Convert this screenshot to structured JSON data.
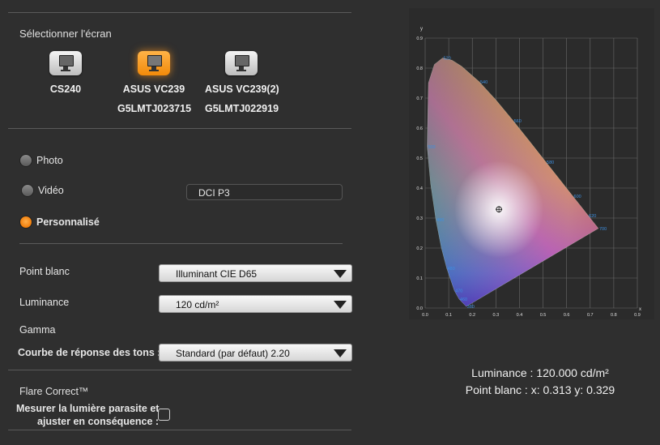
{
  "screen_select": {
    "title": "Sélectionner l'écran",
    "monitors": [
      {
        "name": "CS240",
        "serial": "",
        "active": false
      },
      {
        "name": "ASUS VC239",
        "serial": "G5LMTJ023715",
        "active": true
      },
      {
        "name": "ASUS VC239(2)",
        "serial": "G5LMTJ022919",
        "active": false
      }
    ]
  },
  "modes": {
    "photo": "Photo",
    "video": "Vidéo",
    "custom": "Personnalisé",
    "selected": "custom",
    "video_preset": "DCI P3"
  },
  "settings": {
    "white_point_label": "Point blanc",
    "white_point_value": "Illuminant CIE D65",
    "luminance_label": "Luminance",
    "luminance_value": "120 cd/m²",
    "gamma_label": "Gamma",
    "tone_curve_label": "Courbe de réponse des tons :",
    "tone_curve_value": "Standard (par défaut) 2.20"
  },
  "flare": {
    "title": "Flare Correct™",
    "measure_line1": "Mesurer la lumière parasite et",
    "measure_line2": "ajuster en conséquence :",
    "checked": false
  },
  "readout": {
    "luminance": "Luminance : 120.000 cd/m²",
    "white_point": "Point blanc : x: 0.313  y: 0.329"
  },
  "chart_data": {
    "type": "scatter",
    "title": "",
    "xlabel": "x",
    "ylabel": "y",
    "xlim": [
      0.0,
      0.9
    ],
    "ylim": [
      0.0,
      0.9
    ],
    "ticks": [
      "0.0",
      "0.1",
      "0.2",
      "0.3",
      "0.4",
      "0.5",
      "0.6",
      "0.7",
      "0.8",
      "0.9"
    ],
    "grid": true,
    "wavelength_labels": [
      {
        "text": "520",
        "x": 0.074,
        "y": 0.834
      },
      {
        "text": "540",
        "x": 0.23,
        "y": 0.754
      },
      {
        "text": "560",
        "x": 0.373,
        "y": 0.624
      },
      {
        "text": "580",
        "x": 0.512,
        "y": 0.487
      },
      {
        "text": "600",
        "x": 0.627,
        "y": 0.373
      },
      {
        "text": "620",
        "x": 0.691,
        "y": 0.308
      },
      {
        "text": "700",
        "x": 0.735,
        "y": 0.265
      },
      {
        "text": "500",
        "x": 0.008,
        "y": 0.538
      },
      {
        "text": "490",
        "x": 0.045,
        "y": 0.295
      },
      {
        "text": "480",
        "x": 0.091,
        "y": 0.133
      },
      {
        "text": "470",
        "x": 0.124,
        "y": 0.058
      },
      {
        "text": "460",
        "x": 0.144,
        "y": 0.03
      },
      {
        "text": "380",
        "x": 0.174,
        "y": 0.005
      }
    ],
    "white_point": {
      "x": 0.313,
      "y": 0.329
    }
  }
}
